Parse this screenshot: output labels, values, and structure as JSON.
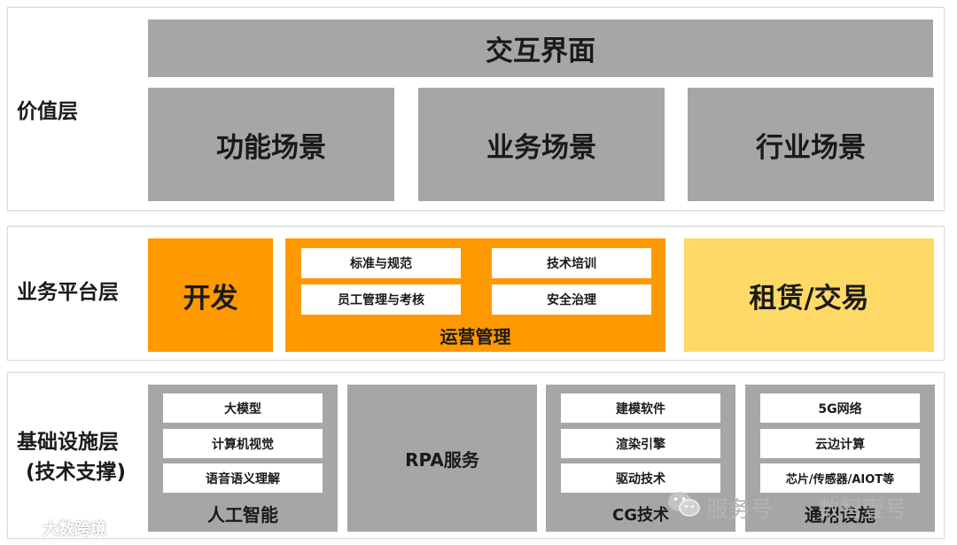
{
  "value_layer": {
    "label": "价值层",
    "interaction": "交互界面",
    "scenes": [
      "功能场景",
      "业务场景",
      "行业场景"
    ]
  },
  "platform_layer": {
    "label": "业务平台层",
    "dev": "开发",
    "ops_items": [
      "标准与规范",
      "技术培训",
      "员工管理与考核",
      "安全治理"
    ],
    "ops_title": "运营管理",
    "rent": "租赁/交易"
  },
  "infra_layer": {
    "label_line1": "基础设施层",
    "label_line2": "(技术支撑)",
    "ai": {
      "items": [
        "大模型",
        "计算机视觉",
        "语音语义理解"
      ],
      "title": "人工智能"
    },
    "rpa": "RPA服务",
    "cg": {
      "items": [
        "建模软件",
        "渲染引擎",
        "驱动技术"
      ],
      "title": "CG技术"
    },
    "general": {
      "items": [
        "5G网络",
        "云边计算",
        "芯片/传感器/AIOT等"
      ],
      "title": "通用设施"
    }
  },
  "watermarks": {
    "service": "服务号",
    "account": "数智壹号",
    "brand": "大数跨境"
  },
  "colors": {
    "gray": "#a6a6a6",
    "orange": "#ff9900",
    "yellow": "#ffd966"
  }
}
